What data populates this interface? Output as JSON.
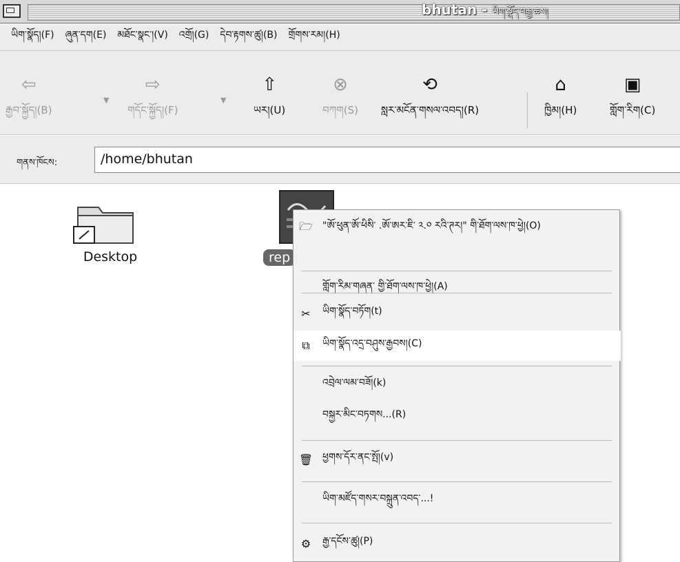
{
  "window": {
    "title_main": "bhutan -",
    "title_sub": "ཡིག་སྣོད་བརྒྱ་ཆས།"
  },
  "menubar": {
    "items": [
      "ཡིག་སྣོད།(F)",
      "ཞུན་དག(E)",
      "མཐོང་སྣང་།(V)",
      "འགྲོ།(G)",
      "དེབ་རྟགས་ཚུ།(B)",
      "གྲོགས་རམ།(H)"
    ]
  },
  "toolbar": {
    "back": "རྒྱབ་སྐྱོད།(B)",
    "forward": "གདོང་སྐྱོད།(F)",
    "up": "ཡར།(U)",
    "stop": "བཀག(S)",
    "reload": "སླར་མངོན་གསལ་འབད།(R)",
    "home": "ཁྱིམ།(H)",
    "computer": "གློག་རིག(C)"
  },
  "location": {
    "label": "གནས་ཁོངས:",
    "value": "/home/bhutan"
  },
  "files": {
    "desktop": "Desktop",
    "report": "rep"
  },
  "context_menu": {
    "open_with": "\"ཨོ་ཕུན་ཨོ་ཕིསི་ .ཨོ་ཨར་ཇི་ ༢.༠ རའི་ཊར།\" གི་ཐོག་ལས་ཁ་ཕྱེ།(O)",
    "open_other": "གློག་རིམ་གཞན་ གྱི་ཐོག་ལས་ཁ་ཕྱེ།(A)",
    "cut": "ཡིག་སྣོད་བཏོག(t)",
    "copy": "ཡིག་སྣོད་འདྲ་བཤུས་རྒྱབས།(C)",
    "make_link": "འབྲེལ་ལམ་བཟོ།(k)",
    "rename": "བསྐྱར་མིང་བཏགས...(R)",
    "trash": "ཕྱགས་དོར་ནང་སྤོ།(v)",
    "emblem": "ཡིག་མཛོད་གསར་བསྐྲུན་འབད་...!",
    "properties": "རྒྱ་དངོས་ཚུ།(P)"
  }
}
